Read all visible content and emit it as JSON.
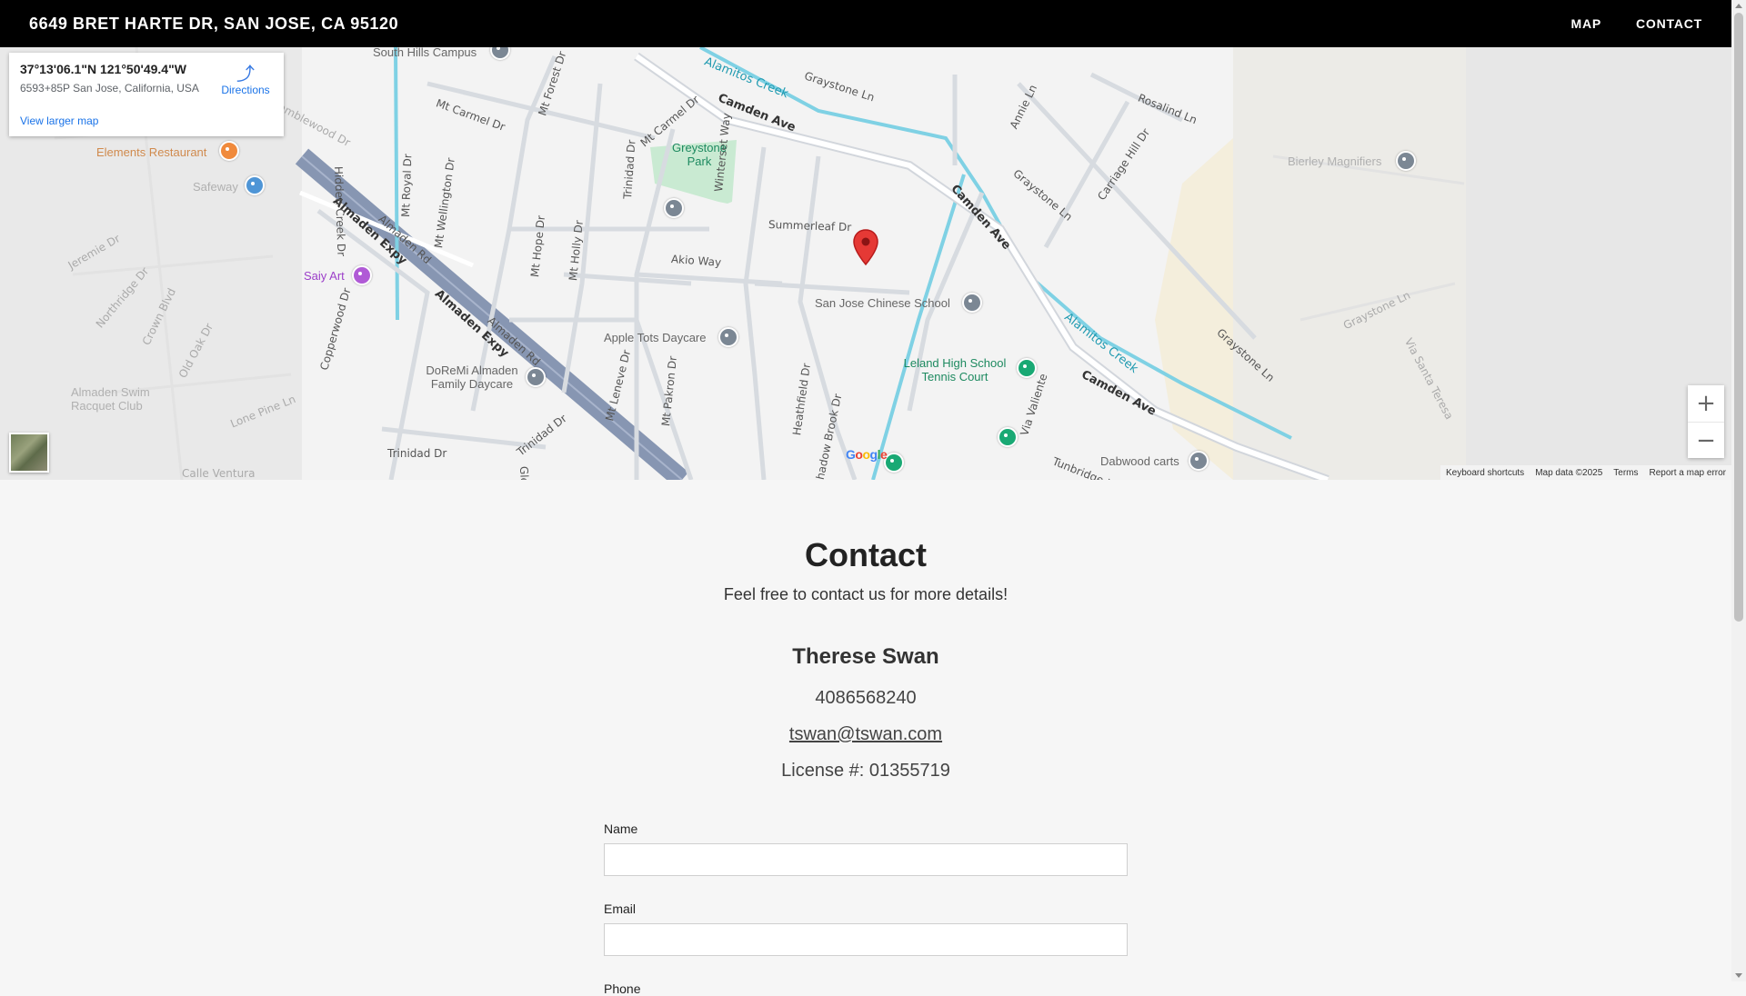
{
  "header": {
    "title": "6649 BRET HARTE DR, SAN JOSE, CA 95120",
    "nav": [
      "MAP",
      "CONTACT"
    ]
  },
  "map": {
    "infocard": {
      "coords": "37°13'06.1\"N 121°50'49.4\"W",
      "plus_code": "6593+85P San Jose, California, USA",
      "directions": "Directions",
      "larger_map": "View larger map"
    },
    "streets": [
      "Camden Ave",
      "Camden Ave",
      "Camden Ave",
      "Alamitos Creek",
      "Alamitos Creek",
      "Almaden Expy",
      "Almaden Expy",
      "Almaden Rd",
      "Almaden Rd",
      "Summerleaf Dr",
      "Akio Way",
      "Graystone Ln",
      "Graystone Ln",
      "Graystone Ln",
      "Graystone Ln",
      "Rosalind Ln",
      "Carriage Hill Dr",
      "Mt Carmel Dr",
      "Mt Carmel Dr",
      "Mt Forest Dr",
      "Mt Royal Dr",
      "Mt Wellington Dr",
      "Mt Hope Dr",
      "Mt Holly Dr",
      "Mt Leneve Dr",
      "Mt Pakron Dr",
      "Trinidad Dr",
      "Trinidad Dr",
      "Trinidad Dr",
      "Winterset Way",
      "Hidden Creek Dr",
      "Heathfield Dr",
      "Shadow Brook Dr",
      "Via Valiente",
      "Tunbridge Ln",
      "Copperwood Dr",
      "Ramblewood Dr",
      "Annie Ln",
      "Crown Blvd",
      "Old Oak Dr",
      "Jeremie Dr",
      "Northridge Dr",
      "Lone Pine Ln",
      "Calle Ventura",
      "Via Santa Teresa",
      "Glen Way"
    ],
    "pois": [
      "South Hills Campus",
      "Greystone Park",
      "Elements Restaurant",
      "Safeway",
      "Saiy Art",
      "San Jose Chinese School",
      "Apple Tots Daycare",
      "DoReMi Almaden Family Daycare",
      "Leland High School Tennis Court",
      "Dabwood carts",
      "Bierley Magnifiers",
      "Almaden Swim Racquet Club"
    ],
    "zoom_in": "+",
    "zoom_out": "−",
    "google": "Google",
    "attribution": [
      "Keyboard shortcuts",
      "Map data ©2025",
      "Terms",
      "Report a map error"
    ]
  },
  "contact": {
    "title": "Contact",
    "subtitle": "Feel free to contact us for more details!",
    "agent_name": "Therese Swan",
    "phone": "4086568240",
    "email": "tswan@tswan.com",
    "license": "License #: 01355719"
  },
  "form": {
    "name_label": "Name",
    "email_label": "Email",
    "phone_label": "Phone"
  }
}
